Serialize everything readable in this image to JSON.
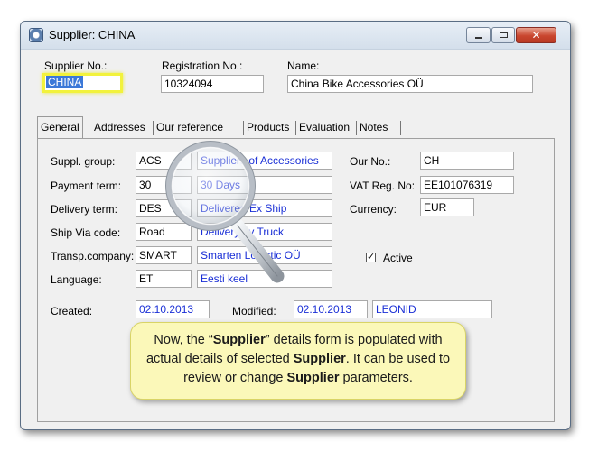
{
  "window": {
    "title": "Supplier: CHINA",
    "close_glyph": "✕"
  },
  "header": {
    "supplier_no_label": "Supplier No.:",
    "supplier_no_value": "CHINA",
    "registration_no_label": "Registration No.:",
    "registration_no_value": "10324094",
    "name_label": "Name:",
    "name_value": "China Bike Accessories OÜ"
  },
  "tabs": [
    {
      "label": "General",
      "active": true
    },
    {
      "label": "Addresses"
    },
    {
      "label": "Our reference"
    },
    {
      "label": "Products"
    },
    {
      "label": "Evaluation"
    },
    {
      "label": "Notes"
    }
  ],
  "general": {
    "suppl_group_label": "Suppl. group:",
    "suppl_group_code": "ACS",
    "suppl_group_desc": "Suppliers of Accessories",
    "payment_term_label": "Payment term:",
    "payment_term_code": "30",
    "payment_term_desc": "30 Days",
    "delivery_term_label": "Delivery term:",
    "delivery_term_code": "DES",
    "delivery_term_desc": "Delivered Ex Ship",
    "ship_via_label": "Ship Via code:",
    "ship_via_code": "Road",
    "ship_via_desc": "Delivery by Truck",
    "transp_company_label": "Transp.company:",
    "transp_company_code": "SMART",
    "transp_company_desc": "Smarten Logistic OÜ",
    "language_label": "Language:",
    "language_code": "ET",
    "language_desc": "Eesti keel",
    "our_no_label": "Our No.:",
    "our_no_value": "CH",
    "vat_reg_label": "VAT Reg. No:",
    "vat_reg_value": "EE101076319",
    "currency_label": "Currency:",
    "currency_value": "EUR",
    "active_label": "Active",
    "active_checked": true,
    "active_mark": "✓",
    "created_label": "Created:",
    "created_value": "02.10.2013",
    "modified_label": "Modified:",
    "modified_value": "02.10.2013",
    "modified_by": "LEONID"
  },
  "callout": {
    "part1": "Now, the “",
    "bold1": "Supplier",
    "part2": "” details form is populated with actual details of selected ",
    "bold2": "Supplier",
    "part3": ".  It can be used to review or change ",
    "bold3": "Supplier",
    "part4": " parameters."
  },
  "colors": {
    "highlight": "#f2f23c",
    "blue_text": "#1a2fd6",
    "callout_bg": "#fbf8b9"
  }
}
